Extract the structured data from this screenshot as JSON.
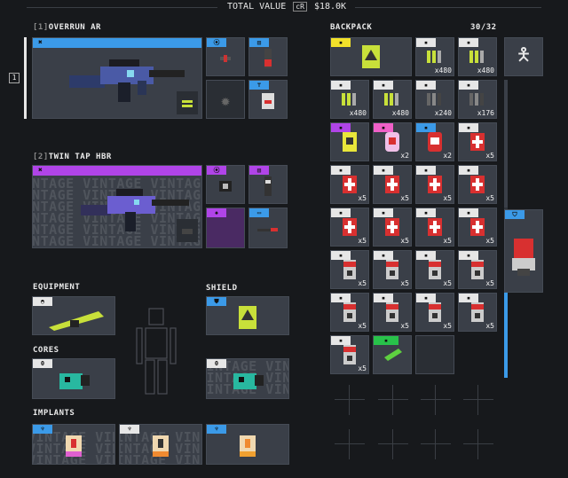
{
  "header": {
    "total_label": "TOTAL VALUE",
    "currency": "cR",
    "total_value": "$18.0K"
  },
  "colors": {
    "blue": "#3b9ae8",
    "purple": "#b044e8",
    "yellow": "#f2e12a",
    "white": "#e6e6e6",
    "green": "#28c24a",
    "pink": "#f060c8"
  },
  "weapons": [
    {
      "index": "[1]",
      "name": "OVERRUN AR",
      "rarity": "blue",
      "selected_marker": "1"
    },
    {
      "index": "[2]",
      "name": "TWIN TAP HBR",
      "rarity": "purple",
      "watermark": "VINTAGE"
    }
  ],
  "equipment": {
    "title": "EQUIPMENT"
  },
  "shield": {
    "title": "SHIELD"
  },
  "cores": {
    "title": "CORES",
    "count_a": "0",
    "count_b": "0",
    "watermark": "VINTAGE"
  },
  "implants": {
    "title": "IMPLANTS",
    "watermark": "VINTAGE"
  },
  "backpack": {
    "title": "BACKPACK",
    "capacity": "30/32",
    "rows": [
      [
        {
          "tag": "yellow",
          "wide": true
        },
        {
          "tag": "white",
          "qty": "x480"
        },
        {
          "tag": "white",
          "qty": "x480"
        }
      ],
      [
        {
          "tag": "white",
          "qty": "x480"
        },
        {
          "tag": "white",
          "qty": "x480"
        },
        {
          "tag": "white",
          "qty": "x240"
        },
        {
          "tag": "white",
          "qty": "x176"
        }
      ],
      [
        {
          "tag": "purple",
          "qty": ""
        },
        {
          "tag": "pink",
          "qty": "x2"
        },
        {
          "tag": "blue",
          "qty": "x2"
        },
        {
          "tag": "white",
          "qty": "x5"
        }
      ],
      [
        {
          "tag": "white",
          "qty": "x5"
        },
        {
          "tag": "white",
          "qty": "x5"
        },
        {
          "tag": "white",
          "qty": "x5"
        },
        {
          "tag": "white",
          "qty": "x5"
        }
      ],
      [
        {
          "tag": "white",
          "qty": "x5"
        },
        {
          "tag": "white",
          "qty": "x5"
        },
        {
          "tag": "white",
          "qty": "x5"
        },
        {
          "tag": "white",
          "qty": "x5"
        }
      ],
      [
        {
          "tag": "white",
          "qty": "x5"
        },
        {
          "tag": "white",
          "qty": "x5"
        },
        {
          "tag": "white",
          "qty": "x5"
        },
        {
          "tag": "white",
          "qty": "x5"
        }
      ],
      [
        {
          "tag": "white",
          "qty": "x5"
        },
        {
          "tag": "white",
          "qty": "x5"
        },
        {
          "tag": "white",
          "qty": "x5"
        },
        {
          "tag": "white",
          "qty": "x5"
        }
      ],
      [
        {
          "tag": "white",
          "qty": "x5"
        },
        {
          "tag": "green",
          "qty": ""
        },
        {
          "tag": "",
          "qty": ""
        }
      ]
    ]
  }
}
